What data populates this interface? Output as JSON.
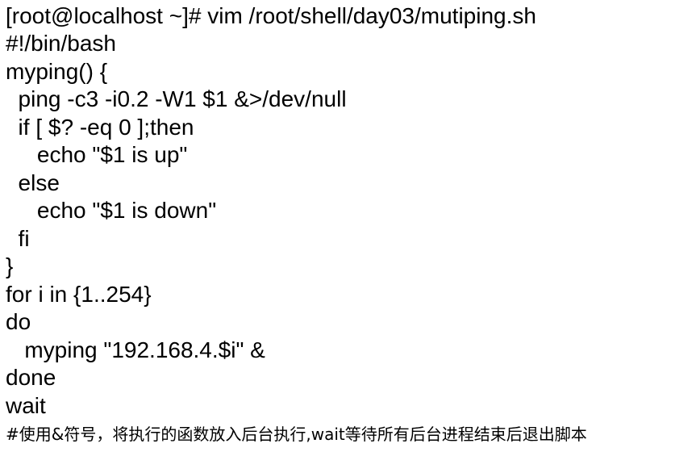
{
  "document": {
    "lines": [
      "[root@localhost ~]# vim /root/shell/day03/mutiping.sh",
      "#!/bin/bash",
      "myping() {",
      "  ping -c3 -i0.2 -W1 $1 &>/dev/null",
      "  if [ $? -eq 0 ];then",
      "     echo \"$1 is up\"",
      "  else",
      "     echo \"$1 is down\"",
      "  fi",
      "}",
      "for i in {1..254}",
      "do",
      "   myping \"192.168.4.$i\" &",
      "done",
      "wait"
    ],
    "comment": "#使用&符号，将执行的函数放入后台执行,wait等待所有后台进程结束后退出脚本"
  }
}
